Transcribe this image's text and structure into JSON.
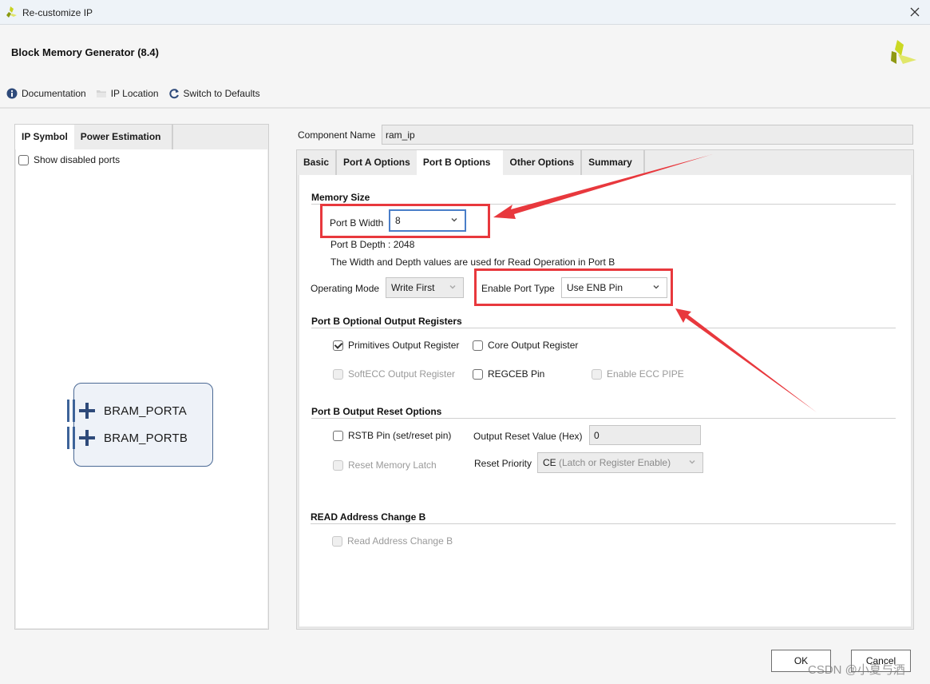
{
  "window": {
    "title": "Re-customize IP",
    "close_icon": "close-icon"
  },
  "header": {
    "title": "Block Memory Generator (8.4)"
  },
  "toolbar": {
    "items": [
      {
        "label": "Documentation",
        "icon": "info-icon"
      },
      {
        "label": "IP Location",
        "icon": "folder-icon"
      },
      {
        "label": "Switch to Defaults",
        "icon": "refresh-icon"
      }
    ]
  },
  "left_panel": {
    "tabs": [
      {
        "label": "IP Symbol",
        "active": true
      },
      {
        "label": "Power Estimation",
        "active": false
      }
    ],
    "show_disabled_ports": {
      "label": "Show disabled ports",
      "checked": false
    },
    "symbol": {
      "ports": [
        "BRAM_PORTA",
        "BRAM_PORTB"
      ]
    }
  },
  "component": {
    "label": "Component Name",
    "value": "ram_ip"
  },
  "tabs": [
    {
      "label": "Basic",
      "active": false
    },
    {
      "label": "Port A Options",
      "active": false
    },
    {
      "label": "Port B Options",
      "active": true
    },
    {
      "label": "Other Options",
      "active": false
    },
    {
      "label": "Summary",
      "active": false
    }
  ],
  "memory_size": {
    "title": "Memory Size",
    "port_b_width_label": "Port B Width",
    "port_b_width_value": "8",
    "port_b_depth": "Port B Depth : 2048",
    "note": "The Width and Depth values are used for Read Operation in Port B",
    "operating_mode_label": "Operating Mode",
    "operating_mode_value": "Write First",
    "enable_port_type_label": "Enable Port Type",
    "enable_port_type_value": "Use ENB Pin"
  },
  "output_registers": {
    "title": "Port B Optional Output Registers",
    "options": [
      {
        "label": "Primitives Output Register",
        "checked": true,
        "disabled": false
      },
      {
        "label": "Core Output Register",
        "checked": false,
        "disabled": false
      },
      {
        "label": "SoftECC Output Register",
        "checked": false,
        "disabled": true
      },
      {
        "label": "REGCEB Pin",
        "checked": false,
        "disabled": false
      },
      {
        "label": "Enable ECC PIPE",
        "checked": false,
        "disabled": true
      }
    ]
  },
  "reset_options": {
    "title": "Port B Output Reset Options",
    "rstb_pin": {
      "label": "RSTB Pin (set/reset pin)",
      "checked": false,
      "disabled": false
    },
    "reset_memory_latch": {
      "label": "Reset Memory Latch",
      "checked": false,
      "disabled": true
    },
    "output_reset_value_label": "Output Reset Value (Hex)",
    "output_reset_value": "0",
    "reset_priority_label": "Reset Priority",
    "reset_priority_value_prefix": "CE",
    "reset_priority_value_suffix": " (Latch or Register Enable)"
  },
  "read_address_change": {
    "title": "READ Address Change B",
    "option": {
      "label": "Read Address Change B",
      "checked": false,
      "disabled": true
    }
  },
  "footer": {
    "ok_label": "OK",
    "cancel_label": "Cancel"
  },
  "annotations": {
    "color": "#e8383d"
  },
  "watermark": "CSDN @小夏与酒"
}
